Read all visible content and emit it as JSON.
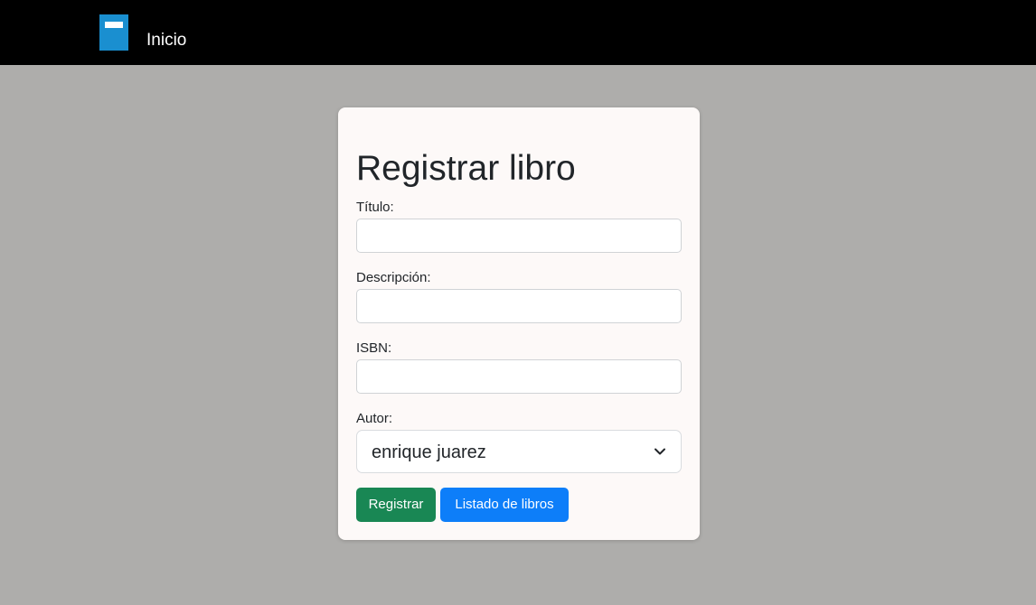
{
  "navbar": {
    "logo_icon": "book-icon",
    "logo_color": "#1a8fd0",
    "home_link": "Inicio"
  },
  "form": {
    "title": "Registrar libro",
    "fields": {
      "title": {
        "label": "Título:",
        "value": "",
        "placeholder": ""
      },
      "description": {
        "label": "Descripción:",
        "value": "",
        "placeholder": ""
      },
      "isbn": {
        "label": "ISBN:",
        "value": "",
        "placeholder": ""
      },
      "author": {
        "label": "Autor:",
        "selected": "enrique juarez",
        "icon": "chevron-down-icon"
      }
    },
    "buttons": {
      "register": {
        "label": "Registrar",
        "color": "#198754"
      },
      "list": {
        "label": "Listado de libros",
        "color": "#0d7ef9"
      }
    }
  },
  "colors": {
    "page_background": "#aeadab",
    "navbar_background": "#000000",
    "card_background": "#fdf9f8"
  }
}
